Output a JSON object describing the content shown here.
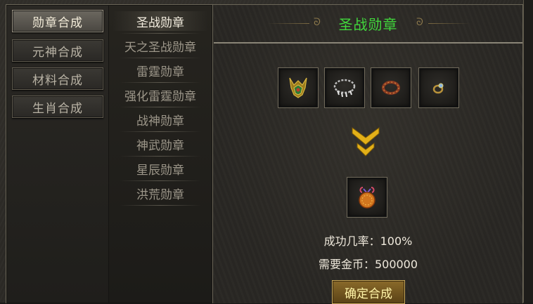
{
  "categories": [
    {
      "label": "勋章合成",
      "active": true
    },
    {
      "label": "元神合成",
      "active": false
    },
    {
      "label": "材料合成",
      "active": false
    },
    {
      "label": "生肖合成",
      "active": false
    }
  ],
  "medals": [
    {
      "label": "圣战勋章",
      "active": true
    },
    {
      "label": "天之圣战勋章",
      "active": false
    },
    {
      "label": "雷霆勋章",
      "active": false
    },
    {
      "label": "强化雷霆勋章",
      "active": false
    },
    {
      "label": "战神勋章",
      "active": false
    },
    {
      "label": "神武勋章",
      "active": false
    },
    {
      "label": "星辰勋章",
      "active": false
    },
    {
      "label": "洪荒勋章",
      "active": false
    }
  ],
  "panel": {
    "title": "圣战勋章",
    "title_color": "#41d63c",
    "materials": [
      {
        "icon": "helmet-icon"
      },
      {
        "icon": "necklace-icon"
      },
      {
        "icon": "bracelet-icon"
      },
      {
        "icon": "ring-icon"
      }
    ],
    "result": {
      "icon": "medal-icon"
    },
    "success_rate": "成功几率：100%",
    "gold_cost": "需要金币：500000",
    "confirm_label": "确定合成"
  }
}
